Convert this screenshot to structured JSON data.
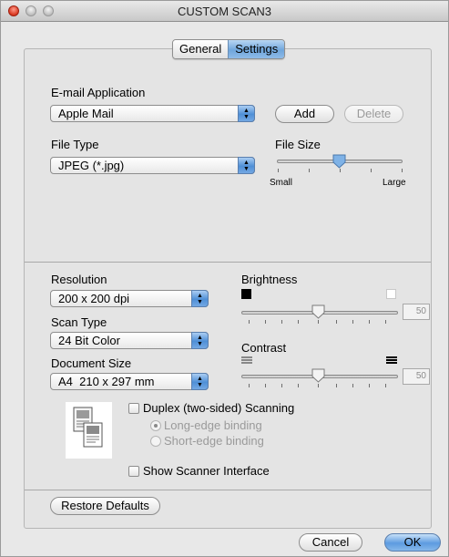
{
  "window": {
    "title": "CUSTOM SCAN3"
  },
  "tabs": [
    {
      "label": "General",
      "active": false
    },
    {
      "label": "Settings",
      "active": true
    }
  ],
  "email": {
    "label": "E-mail Application",
    "value": "Apple Mail",
    "add_label": "Add",
    "delete_label": "Delete"
  },
  "file_type": {
    "label": "File Type",
    "value": "JPEG (*.jpg)"
  },
  "file_size": {
    "label": "File Size",
    "min_label": "Small",
    "max_label": "Large",
    "position": 0.5
  },
  "resolution": {
    "label": "Resolution",
    "value": "200 x 200 dpi"
  },
  "scan_type": {
    "label": "Scan Type",
    "value": "24 Bit Color"
  },
  "document_size": {
    "label": "Document Size",
    "value": "A4  210 x 297 mm"
  },
  "brightness": {
    "label": "Brightness",
    "value": "50"
  },
  "contrast": {
    "label": "Contrast",
    "value": "50"
  },
  "duplex": {
    "label": "Duplex (two-sided) Scanning",
    "checked": false,
    "long_edge_label": "Long-edge binding",
    "short_edge_label": "Short-edge binding",
    "selected": "long-edge"
  },
  "show_scanner": {
    "label": "Show Scanner Interface",
    "checked": false
  },
  "buttons": {
    "restore_defaults": "Restore Defaults",
    "cancel": "Cancel",
    "ok": "OK"
  },
  "icons": {
    "popup_arrows": "updown-arrows-icon",
    "brightness_dark": "black-square-icon",
    "brightness_light": "white-square-icon",
    "contrast_low": "low-contrast-bars-icon",
    "contrast_high": "high-contrast-bars-icon",
    "duplex": "duplex-document-icon"
  },
  "colors": {
    "accent": "#6fa6dc",
    "window_bg": "#e8e8e8"
  }
}
